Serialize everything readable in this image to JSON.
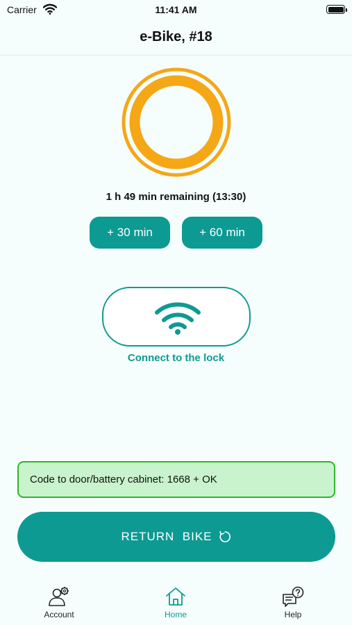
{
  "status_bar": {
    "carrier": "Carrier",
    "time": "11:41 AM",
    "icons": [
      "wifi-icon",
      "battery-icon"
    ]
  },
  "header": {
    "title": "e-Bike, #18"
  },
  "timer": {
    "remaining_text": "1 h 49 min remaining  (13:30)",
    "ring_color": "#f5a716"
  },
  "extend": {
    "plus30_label": "+ 30 min",
    "plus60_label": "+ 60 min"
  },
  "lock": {
    "icon": "wifi-icon",
    "label": "Connect to the lock"
  },
  "code_box": {
    "text": "Code to door/battery cabinet: 1668 + OK",
    "background": "#c8f3cc",
    "border": "#2fb52f"
  },
  "return_button": {
    "label": "RETURN  BIKE",
    "icon": "refresh-icon"
  },
  "tab_bar": {
    "items": [
      {
        "label": "Account",
        "icon": "account-settings-icon",
        "active": false
      },
      {
        "label": "Home",
        "icon": "home-icon",
        "active": true
      },
      {
        "label": "Help",
        "icon": "help-chat-icon",
        "active": false
      }
    ]
  },
  "colors": {
    "accent": "#0d9a92",
    "background": "#f5fdfd"
  }
}
